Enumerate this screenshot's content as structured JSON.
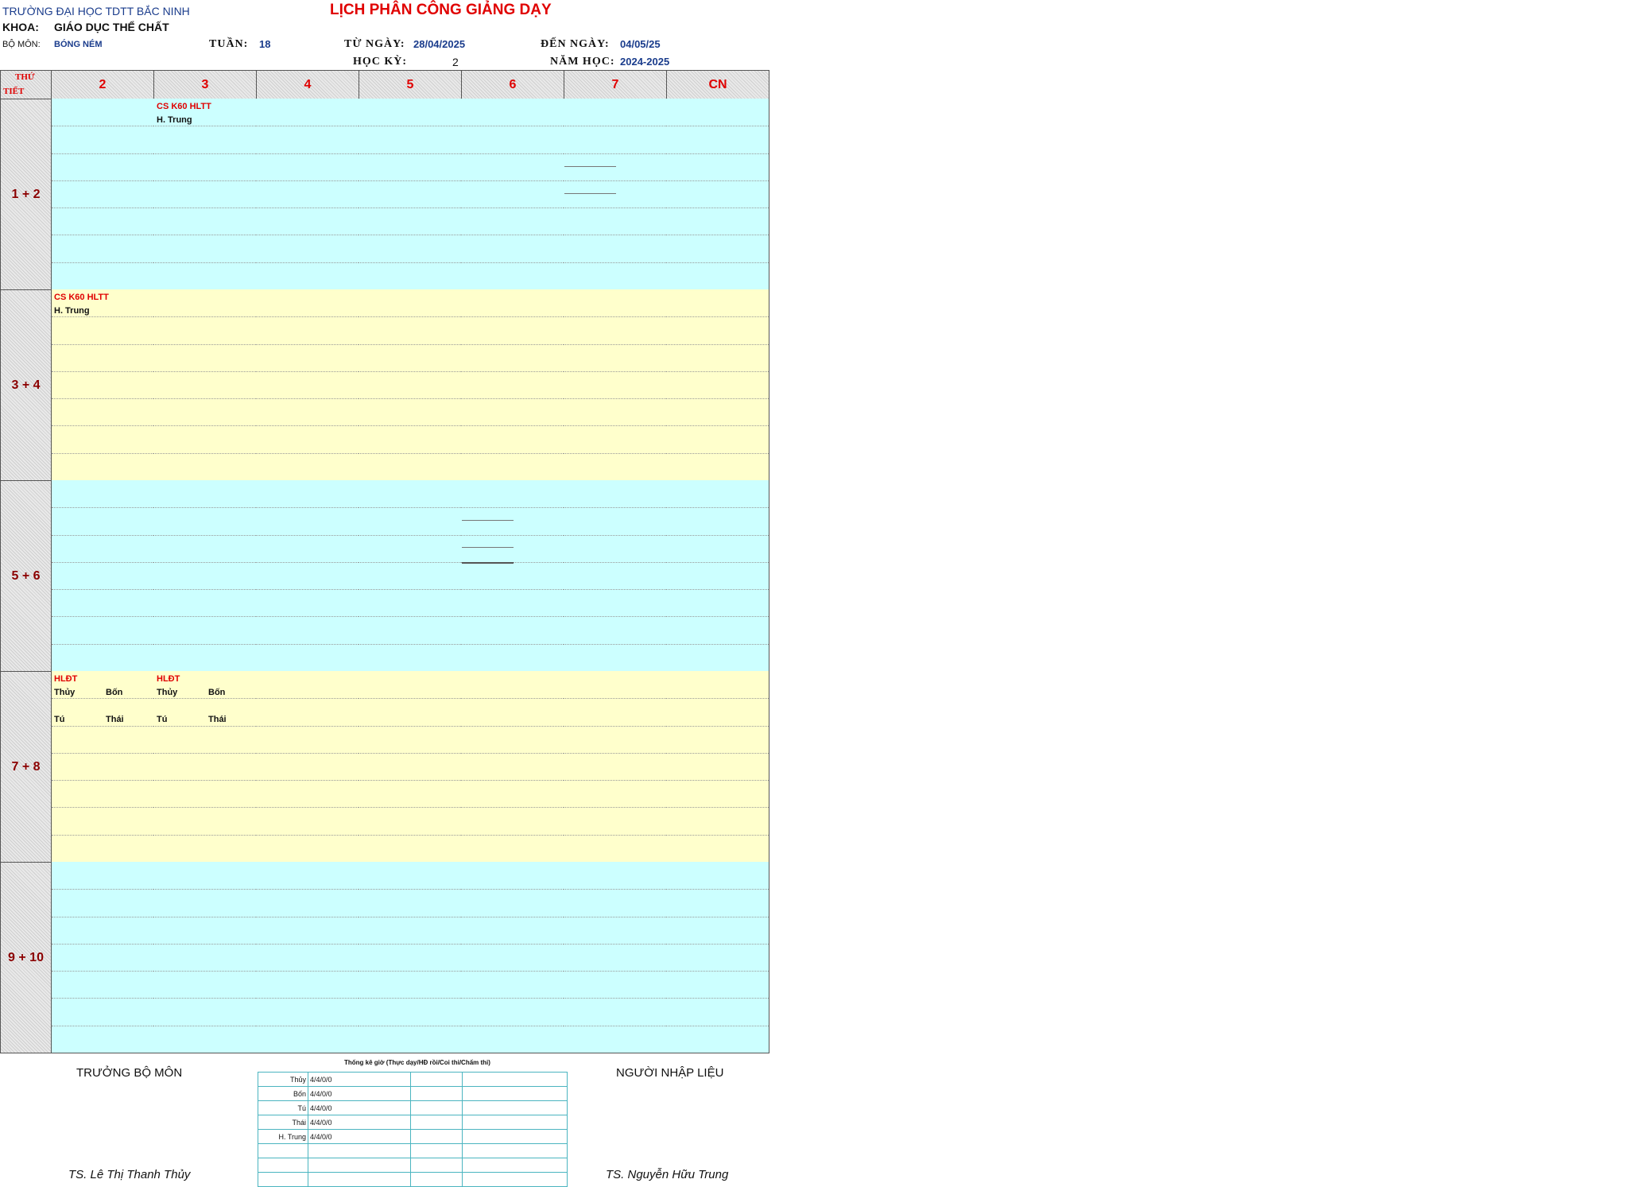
{
  "header": {
    "school": "TRƯỜNG ĐẠI HỌC TDTT BẮC NINH",
    "title": "LỊCH PHÂN CÔNG GIẢNG DẠY",
    "khoa_label": "KHOA:",
    "khoa_value": "GIÁO DỤC THỂ CHẤT",
    "bomon_label": "BỘ MÔN:",
    "bomon_value": "BÓNG NÉM",
    "tuan_label": "TUẦN:",
    "tuan_value": "18",
    "tungay_label": "TỪ NGÀY:",
    "tungay_value": "28/04/2025",
    "denngay_label": "ĐẾN NGÀY:",
    "denngay_value": "04/05/25",
    "hocky_label": "HỌC KỲ:",
    "hocky_value": "2",
    "namhoc_label": "NĂM HỌC:",
    "namhoc_value": "2024-2025"
  },
  "table": {
    "corner_top": "THỨ",
    "corner_bottom": "TIẾT",
    "days": [
      "2",
      "3",
      "4",
      "5",
      "6",
      "7",
      "CN"
    ],
    "periods": [
      "1 + 2",
      "3 + 4",
      "5 + 6",
      "7 + 8",
      "9 + 10"
    ],
    "entries": {
      "p1_d3_class": "CS K60 HLTT",
      "p1_d3_teacher": "H. Trung",
      "p2_d2_class": "CS K60 HLTT",
      "p2_d2_teacher": "H. Trung",
      "p4_d2_class": "HLĐT",
      "p4_d2_t1": "Thủy",
      "p4_d2_t2": "Bốn",
      "p4_d2_t3": "Tú",
      "p4_d2_t4": "Thái",
      "p4_d3_class": "HLĐT",
      "p4_d3_t1": "Thủy",
      "p4_d3_t2": "Bốn",
      "p4_d3_t3": "Tú",
      "p4_d3_t4": "Thái"
    }
  },
  "footer": {
    "left_title": "TRƯỞNG BỘ MÔN",
    "left_name": "TS. Lê Thị Thanh Thủy",
    "right_title": "NGƯỜI NHẬP LIỆU",
    "right_name": "TS. Nguyễn Hữu Trung",
    "stats_caption": "Thống kê giờ (Thực dạy/HĐ rồi/Coi thi/Chấm thi)",
    "stats": [
      {
        "name": "Thủy",
        "value": "4/4/0/0"
      },
      {
        "name": "Bốn",
        "value": "4/4/0/0"
      },
      {
        "name": "Tú",
        "value": "4/4/0/0"
      },
      {
        "name": "Thái",
        "value": "4/4/0/0"
      },
      {
        "name": "H. Trung",
        "value": "4/4/0/0"
      }
    ]
  },
  "colors": {
    "cyan": "#ccffff",
    "yellow": "#ffffcc",
    "red": "#e00000",
    "blue": "#1a3c8c"
  }
}
